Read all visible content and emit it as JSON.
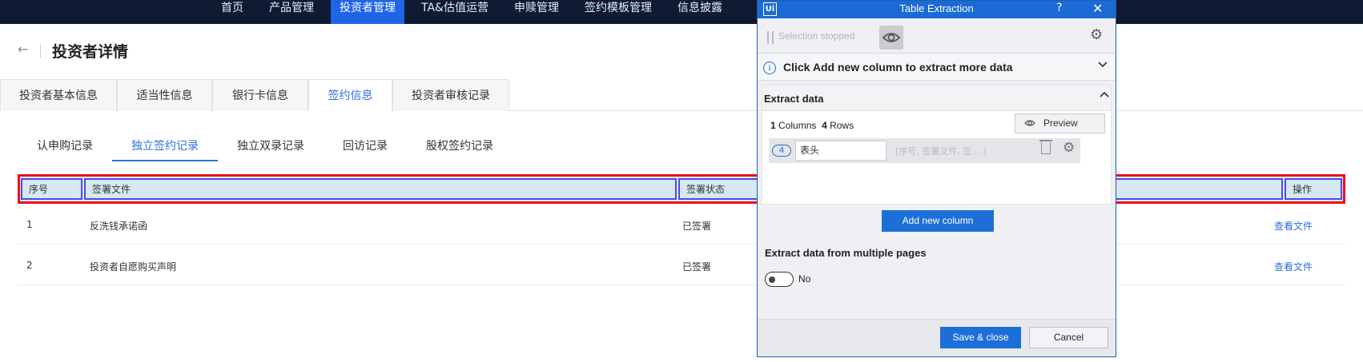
{
  "topnav": {
    "items": [
      {
        "label": "首页"
      },
      {
        "label": "产品管理"
      },
      {
        "label": "投资者管理"
      },
      {
        "label": "TA&估值运营"
      },
      {
        "label": "申赎管理"
      },
      {
        "label": "签约模板管理"
      },
      {
        "label": "信息披露"
      }
    ],
    "active_index": 2
  },
  "page": {
    "back_icon": "←",
    "title": "投资者详情"
  },
  "tabs1": [
    "投资者基本信息",
    "适当性信息",
    "银行卡信息",
    "签约信息",
    "投资者审核记录"
  ],
  "tabs1_active": 3,
  "tabs2": [
    "认申购记录",
    "独立签约记录",
    "独立双录记录",
    "回访记录",
    "股权签约记录"
  ],
  "tabs2_active": 1,
  "table": {
    "headers": [
      "序号",
      "签署文件",
      "签署状态",
      "",
      "操作"
    ],
    "rows": [
      {
        "no": "1",
        "file": "反洗钱承诺函",
        "status": "已签署",
        "action": "查看文件"
      },
      {
        "no": "2",
        "file": "投资者自愿购买声明",
        "status": "已签署",
        "action": "查看文件"
      }
    ]
  },
  "dialog": {
    "logo": "Ui",
    "title": "Table Extraction",
    "help": "?",
    "close": "✕",
    "selection_status": "Selection stopped",
    "info_text": "Click Add new column to extract more data",
    "panel_title": "Extract data",
    "columns_count": "1",
    "columns_label": "Columns",
    "rows_count": "4",
    "rows_label": "Rows",
    "preview_label": "Preview",
    "column": {
      "count": "4",
      "name": "表头",
      "sample": "[序号, 签署文件, 签...   ]"
    },
    "add_column_label": "Add new column",
    "multi_page_label": "Extract data from multiple pages",
    "multi_page_value": "No",
    "save_label": "Save & close",
    "cancel_label": "Cancel"
  },
  "colors": {
    "topbar": "#0f1a33",
    "nav_active": "#1e65e8",
    "accent": "#2f6fde",
    "highlight_red": "#e8111c",
    "dialog_blue": "#1c6ad6"
  }
}
